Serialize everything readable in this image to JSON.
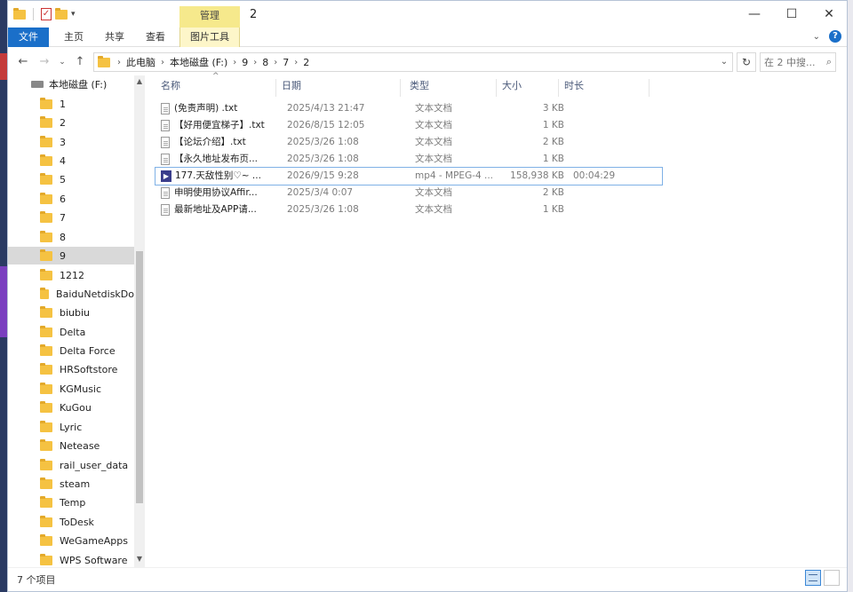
{
  "titlebar": {
    "manage_tab": "管理",
    "title": "2",
    "minimize": "—",
    "maximize": "☐",
    "close": "✕"
  },
  "ribbon": {
    "tabs": [
      "文件",
      "主页",
      "共享",
      "查看",
      "图片工具"
    ]
  },
  "address": {
    "crumbs": [
      "此电脑",
      "本地磁盘 (F:)",
      "9",
      "8",
      "7",
      "2"
    ],
    "search_placeholder": "在 2 中搜..."
  },
  "nav": {
    "drive": "本地磁盘 (F:)",
    "items": [
      "1",
      "2",
      "3",
      "4",
      "5",
      "6",
      "7",
      "8",
      "9",
      "1212",
      "BaiduNetdiskDo",
      "biubiu",
      "Delta",
      "Delta Force",
      "HRSoftstore",
      "KGMusic",
      "KuGou",
      "Lyric",
      "Netease",
      "rail_user_data",
      "steam",
      "Temp",
      "ToDesk",
      "WeGameApps",
      "WPS Software"
    ],
    "selected": "9"
  },
  "columns": {
    "name": "名称",
    "date": "日期",
    "type": "类型",
    "size": "大小",
    "duration": "时长"
  },
  "files": [
    {
      "name": "(免责声明) .txt",
      "date": "2025/4/13 21:47",
      "type": "文本文档",
      "size": "3 KB",
      "duration": "",
      "icon": "doc"
    },
    {
      "name": "【好用便宜梯子】.txt",
      "date": "2026/8/15 12:05",
      "type": "文本文档",
      "size": "1 KB",
      "duration": "",
      "icon": "doc"
    },
    {
      "name": "【论坛介绍】.txt",
      "date": "2025/3/26 1:08",
      "type": "文本文档",
      "size": "2 KB",
      "duration": "",
      "icon": "doc"
    },
    {
      "name": "【永久地址发布页...",
      "date": "2025/3/26 1:08",
      "type": "文本文档",
      "size": "1 KB",
      "duration": "",
      "icon": "doc"
    },
    {
      "name": "177.天敌性别♡~ ...",
      "date": "2026/9/15 9:28",
      "type": "mp4 - MPEG-4 ...",
      "size": "158,938 KB",
      "duration": "00:04:29",
      "icon": "video"
    },
    {
      "name": "申明使用协议Affir...",
      "date": "2025/3/4 0:07",
      "type": "文本文档",
      "size": "2 KB",
      "duration": "",
      "icon": "doc"
    },
    {
      "name": "最新地址及APP请...",
      "date": "2025/3/26 1:08",
      "type": "文本文档",
      "size": "1 KB",
      "duration": "",
      "icon": "doc"
    }
  ],
  "status": {
    "count": "7 个项目"
  },
  "colors": {
    "file_tab": "#1a6fc9",
    "manage_tab": "#f6e98c",
    "selected_nav": "#d9d9d9",
    "selection_outline": "#7fb1e6"
  }
}
